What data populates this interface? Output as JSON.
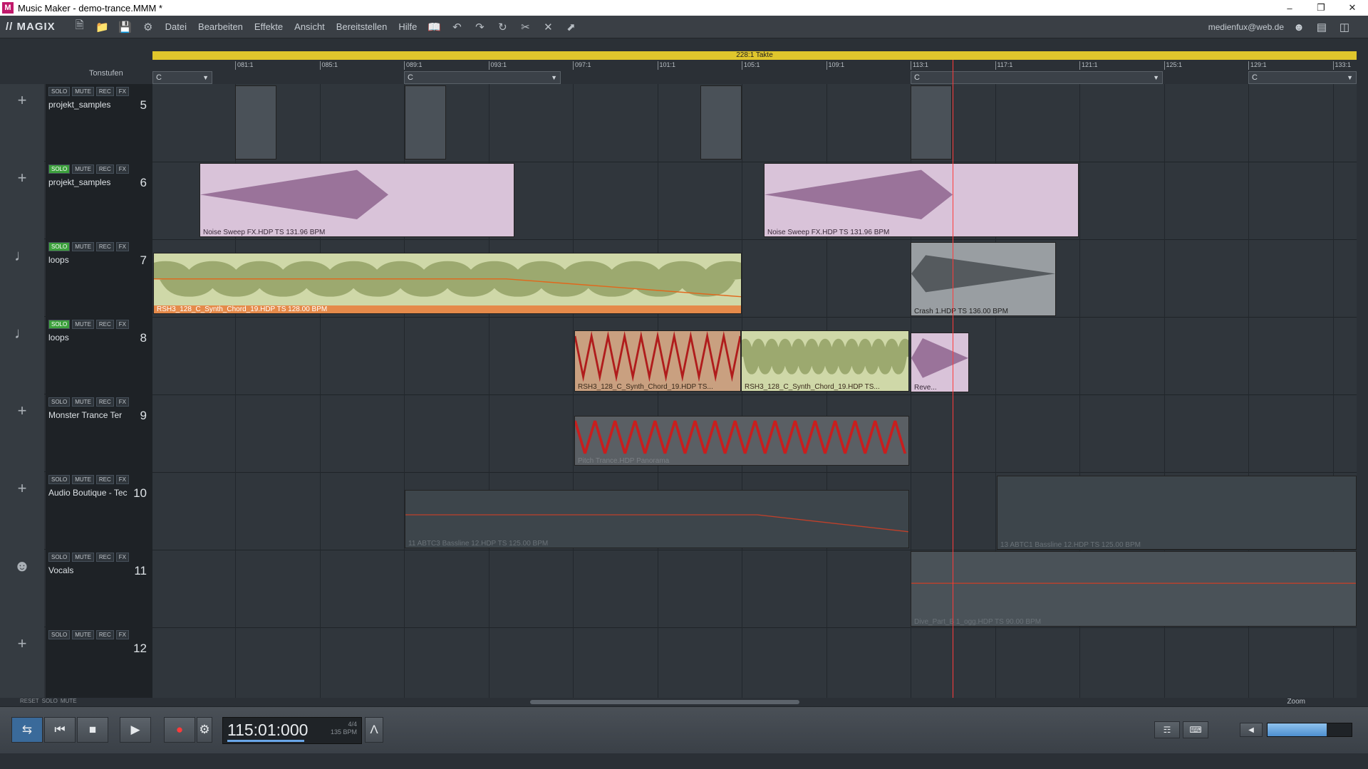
{
  "window": {
    "title": "Music Maker - demo-trance.MMM *",
    "app_icon": "M"
  },
  "menubar": {
    "logo": "// MAGIX",
    "menus": [
      "Datei",
      "Bearbeiten",
      "Effekte",
      "Ansicht",
      "Bereitstellen",
      "Hilfe"
    ],
    "email": "medienfux@web.de"
  },
  "ruler": {
    "length_label": "228:1 Takte",
    "ticks": [
      "081:1",
      "085:1",
      "089:1",
      "093:1",
      "097:1",
      "101:1",
      "105:1",
      "109:1",
      "113:1",
      "117:1",
      "121:1",
      "125:1",
      "129:1",
      "133:1"
    ]
  },
  "tonstufen": "Tonstufen",
  "chords": [
    "C",
    "C",
    "C",
    "C"
  ],
  "track_buttons": {
    "solo": "SOLO",
    "mute": "MUTE",
    "rec": "REC",
    "fx": "FX"
  },
  "tracks": [
    {
      "name": "projekt_samples",
      "number": "5",
      "solo_on": false
    },
    {
      "name": "projekt_samples",
      "number": "6",
      "solo_on": true
    },
    {
      "name": "loops",
      "number": "7",
      "solo_on": true
    },
    {
      "name": "loops",
      "number": "8",
      "solo_on": true
    },
    {
      "name": "Monster Trance Ter",
      "number": "9",
      "solo_on": false
    },
    {
      "name": "Audio Boutique - Tec",
      "number": "10",
      "solo_on": false
    },
    {
      "name": "Vocals",
      "number": "11",
      "solo_on": false
    },
    {
      "name": "",
      "number": "12",
      "solo_on": false
    }
  ],
  "objects": {
    "noise1": "Noise Sweep FX.HDP  TS  131.96 BPM",
    "noise2": "Noise Sweep FX.HDP  TS  131.96 BPM",
    "chord7": "RSH3_128_C_Synth_Chord_19.HDP  TS  128.00 BPM",
    "crash": "Crash 1.HDP  TS  136.00 BPM",
    "chord8a": "RSH3_128_C_Synth_Chord_19.HDP  TS...",
    "chord8b": "RSH3_128_C_Synth_Chord_19.HDP  TS...",
    "reverb": "Reve...",
    "pitch": "Pitch Trance.HDP  Panorama",
    "bass1": "11 ABTC3 Bassline 12.HDP  TS  125.00 BPM",
    "bass2": "13 ABTC1 Bassline 12.HDP  TS  125.00 BPM",
    "vocals": "Dive_Part_B 1_ogg.HDP  TS  90.00 BPM"
  },
  "hscroll": {
    "reset": "RESET",
    "solo": "SOLO",
    "mute": "MUTE",
    "zoom": "Zoom"
  },
  "transport": {
    "time": "115:01:000",
    "signature": "4/4",
    "bpm": "135 BPM",
    "volume": 0.7,
    "accent": "#6aa6e8"
  },
  "icons": [
    "loop-icon",
    "rewind-icon",
    "stop-icon",
    "play-icon",
    "record-icon",
    "settings-icon",
    "metronome-icon"
  ]
}
